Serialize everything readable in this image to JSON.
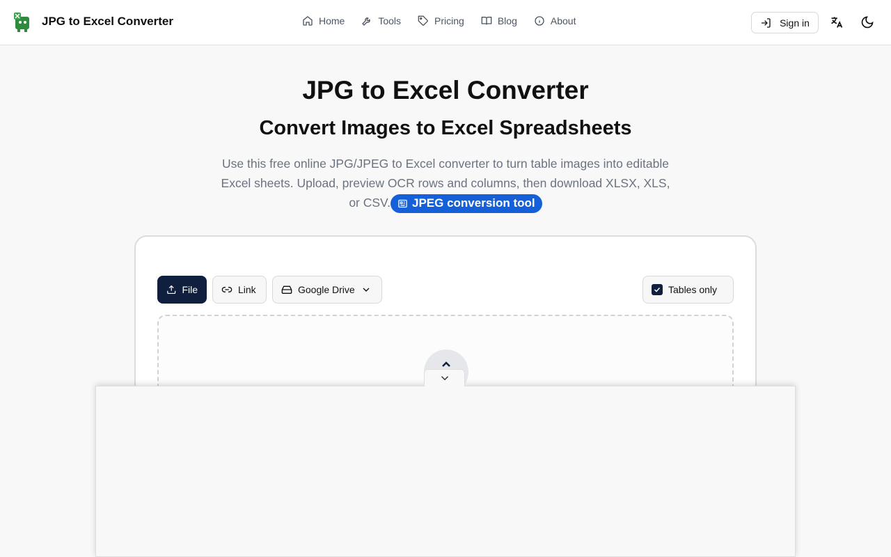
{
  "header": {
    "brand_name": "JPG to Excel Converter",
    "nav": [
      {
        "label": "Home",
        "icon": "home-icon"
      },
      {
        "label": "Tools",
        "icon": "wrench-icon"
      },
      {
        "label": "Pricing",
        "icon": "tag-icon"
      },
      {
        "label": "Blog",
        "icon": "book-icon"
      },
      {
        "label": "About",
        "icon": "info-icon"
      }
    ],
    "signin_label": "Sign in"
  },
  "hero": {
    "title": "JPG to Excel Converter",
    "subtitle": "Convert Images to Excel Spreadsheets",
    "description": "Use this free online JPG/JPEG to Excel converter to turn table images into editable Excel sheets. Upload, preview OCR rows and columns, then download XLSX, XLS, or CSV.",
    "pill_label": "JPEG conversion tool"
  },
  "uploader": {
    "file_label": "File",
    "link_label": "Link",
    "drive_label": "Google Drive",
    "tables_only_label": "Tables only",
    "tables_only_checked": true
  },
  "colors": {
    "primary": "#0f1f3d",
    "accent": "#1560d8",
    "brand_green": "#2e8b3e"
  }
}
